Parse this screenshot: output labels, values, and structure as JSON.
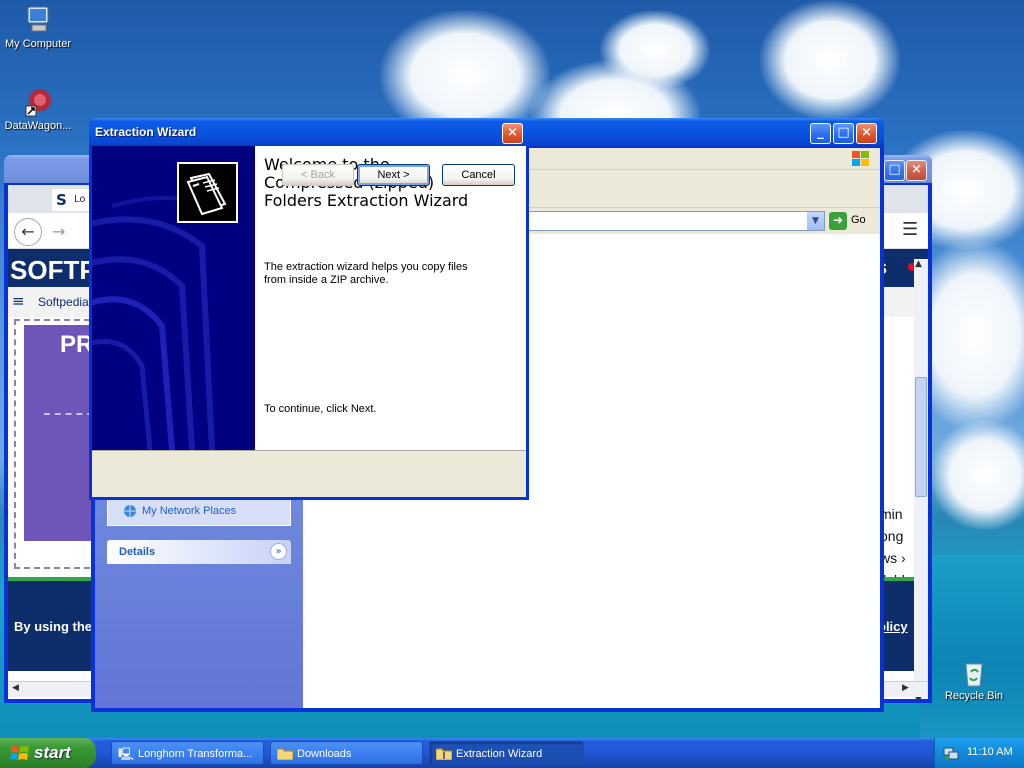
{
  "desktop": {
    "icons": [
      {
        "name": "mycomputer",
        "label": "My Computer"
      },
      {
        "name": "datawagon",
        "label": "DataWagon..."
      },
      {
        "name": "recycle",
        "label": "Recycle Bin"
      }
    ]
  },
  "browser": {
    "tab_label": "Lo",
    "logo_text": "SOFTP",
    "nav_label": "Softpedia",
    "promo_text": "PR",
    "right_fragments": [
      "min",
      "ong",
      "ws ›",
      "ilabl"
    ],
    "consent_text": "By using the s",
    "consent_link": "olicy",
    "right_logo": "s"
  },
  "explorer": {
    "title": "",
    "go_label": "Go",
    "sidebar": {
      "network_places": "My Network Places",
      "details_header": "Details"
    }
  },
  "wizard": {
    "title": "Extraction Wizard",
    "heading": "Welcome to the Compressed (zipped) Folders Extraction Wizard",
    "description": "The extraction wizard helps you copy files from inside a ZIP archive.",
    "continue_text": "To continue, click Next.",
    "back_label": "< Back",
    "next_label": "Next >",
    "cancel_label": "Cancel"
  },
  "taskbar": {
    "start_label": "start",
    "tasks": [
      {
        "label": "Longhorn Transforma...",
        "active": false
      },
      {
        "label": "Downloads",
        "active": false
      },
      {
        "label": "Extraction Wizard",
        "active": true
      }
    ],
    "clock": "11:10 AM"
  },
  "colors": {
    "xp_blue": "#0831d9",
    "wizard_panel": "#000080",
    "softpedia_navy": "#0d2d6b",
    "start_green": "#3c9a36"
  }
}
